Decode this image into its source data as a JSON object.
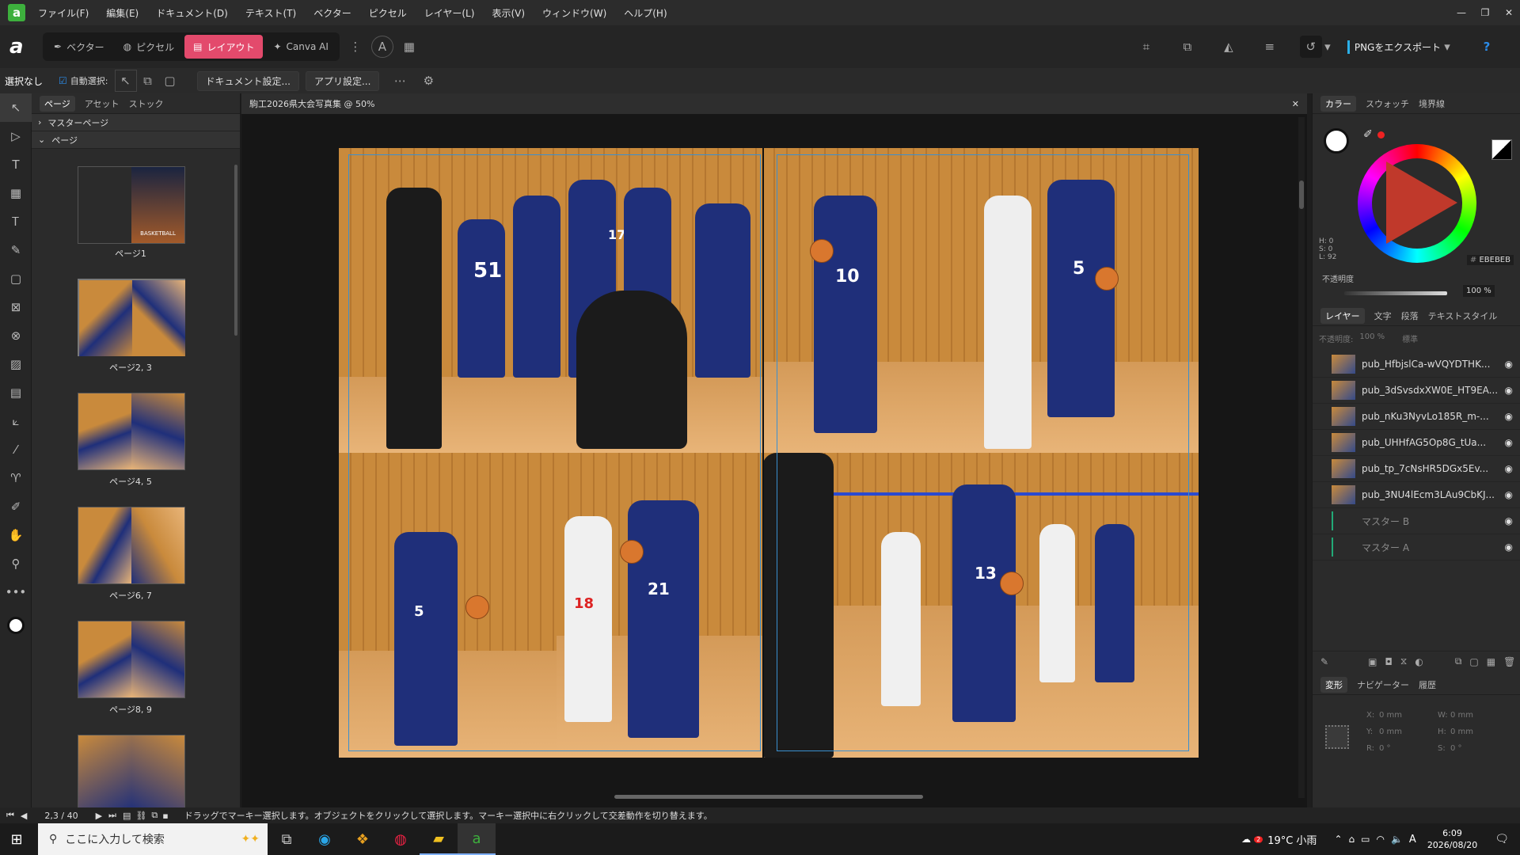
{
  "app": {
    "brand_letter": "a"
  },
  "menu": [
    "ファイル(F)",
    "編集(E)",
    "ドキュメント(D)",
    "テキスト(T)",
    "ベクター",
    "ピクセル",
    "レイヤー(L)",
    "表示(V)",
    "ウィンドウ(W)",
    "ヘルプ(H)"
  ],
  "personas": [
    {
      "label": "ベクター",
      "icon": "vector-icon"
    },
    {
      "label": "ピクセル",
      "icon": "pixel-icon"
    },
    {
      "label": "レイアウト",
      "icon": "layout-icon",
      "active": true
    },
    {
      "label": "Canva AI",
      "icon": "sparkle-icon"
    }
  ],
  "export_label": "PNGをエクスポート",
  "context": {
    "selection": "選択なし",
    "auto_select": "自動選択:",
    "doc_settings": "ドキュメント設定...",
    "app_settings": "アプリ設定..."
  },
  "pages_panel": {
    "tabs": [
      "ページ",
      "アセット",
      "ストック"
    ],
    "master_section": "マスターページ",
    "pages_section": "ページ",
    "pages": [
      "ページ1",
      "ページ2, 3",
      "ページ4, 5",
      "ページ6, 7",
      "ページ8, 9"
    ]
  },
  "document": {
    "tab_title": "駒工2026県大会写真集 @ 50%",
    "cover_text": "BASKETBALL"
  },
  "jerseys": {
    "j10": "10",
    "j5": "5",
    "j51": "51",
    "j17": "17",
    "j21": "21",
    "j18": "18",
    "j13": "13"
  },
  "color_panel": {
    "tabs": [
      "カラー",
      "スウォッチ",
      "境界線"
    ],
    "hsl": {
      "h": "H: 0",
      "s": "S: 0",
      "l": "L: 92"
    },
    "hex": "EBEBEB",
    "opacity_label": "不透明度",
    "opacity_value": "100 %"
  },
  "layers_panel": {
    "tabs": [
      "レイヤー",
      "文字",
      "段落",
      "テキストスタイル"
    ],
    "opacity_label": "不透明度:",
    "opacity_value": "100 %",
    "blend_mode": "標準",
    "layers": [
      "pub_HfbjslCa-wVQYDTHK...",
      "pub_3dSvsdxXW0E_HT9EA...",
      "pub_nKu3NyvLo185R_m-...",
      "pub_UHHfAG5Op8G_tUa...",
      "pub_tp_7cNsHR5DGx5Ev...",
      "pub_3NU4lEcm3LAu9CbKJ..."
    ],
    "masters": [
      "マスター B",
      "マスター A"
    ]
  },
  "transform_panel": {
    "tabs": [
      "変形",
      "ナビゲーター",
      "履歴"
    ],
    "x": "X:",
    "x_val": "0 mm",
    "y": "Y:",
    "y_val": "0 mm",
    "w": "W:",
    "w_val": "0 mm",
    "h": "H:",
    "h_val": "0 mm",
    "r": "R:",
    "r_val": "0 °",
    "s": "S:",
    "s_val": "0 °"
  },
  "status": {
    "page_counter": "2,3 / 40",
    "hint": "ドラッグでマーキー選択します。オブジェクトをクリックして選択します。マーキー選択中に右クリックして交差動作を切り替えます。"
  },
  "taskbar": {
    "search_placeholder": "ここに入力して検索",
    "weather": "19°C 小雨",
    "time": "6:09",
    "date": "2026/08/20",
    "notif_count": "2"
  },
  "colors": {
    "accent": "#e34a6c",
    "jersey": "#1f2f7a",
    "court": "#c98a3c"
  }
}
